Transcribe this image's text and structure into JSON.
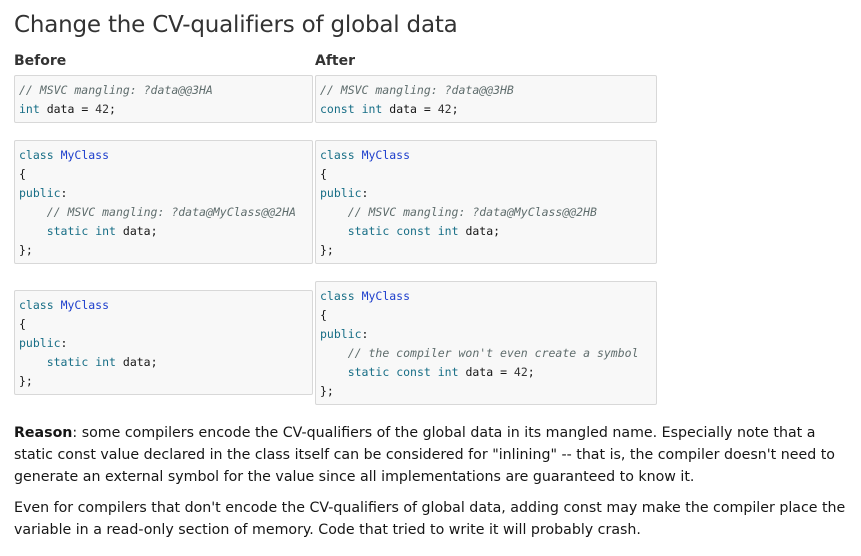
{
  "title": "Change the CV-qualifiers of global data",
  "columns": {
    "before": "Before",
    "after": "After"
  },
  "blocks": [
    {
      "id": "b1-before",
      "lines": [
        [
          {
            "c": "cmt",
            "t": "// MSVC mangling: ?data@@3HA"
          }
        ],
        [
          {
            "c": "kw",
            "t": "int"
          },
          {
            "c": "txt",
            "t": " data = "
          },
          {
            "c": "num",
            "t": "42"
          },
          {
            "c": "txt",
            "t": ";"
          }
        ]
      ]
    },
    {
      "id": "b1-after",
      "lines": [
        [
          {
            "c": "cmt",
            "t": "// MSVC mangling: ?data@@3HB"
          }
        ],
        [
          {
            "c": "kw",
            "t": "const"
          },
          {
            "c": "txt",
            "t": " "
          },
          {
            "c": "kw",
            "t": "int"
          },
          {
            "c": "txt",
            "t": " data = "
          },
          {
            "c": "num",
            "t": "42"
          },
          {
            "c": "txt",
            "t": ";"
          }
        ]
      ]
    },
    {
      "id": "b2-before",
      "lines": [
        [
          {
            "c": "kw",
            "t": "class"
          },
          {
            "c": "txt",
            "t": " "
          },
          {
            "c": "cls",
            "t": "MyClass"
          }
        ],
        [
          {
            "c": "txt",
            "t": "{"
          }
        ],
        [
          {
            "c": "kw",
            "t": "public"
          },
          {
            "c": "txt",
            "t": ":"
          }
        ],
        [
          {
            "c": "txt",
            "t": "    "
          },
          {
            "c": "cmt",
            "t": "// MSVC mangling: ?data@MyClass@@2HA"
          }
        ],
        [
          {
            "c": "txt",
            "t": "    "
          },
          {
            "c": "kw",
            "t": "static"
          },
          {
            "c": "txt",
            "t": " "
          },
          {
            "c": "kw",
            "t": "int"
          },
          {
            "c": "txt",
            "t": " data;"
          }
        ],
        [
          {
            "c": "txt",
            "t": "};"
          }
        ]
      ]
    },
    {
      "id": "b2-after",
      "lines": [
        [
          {
            "c": "kw",
            "t": "class"
          },
          {
            "c": "txt",
            "t": " "
          },
          {
            "c": "cls",
            "t": "MyClass"
          }
        ],
        [
          {
            "c": "txt",
            "t": "{"
          }
        ],
        [
          {
            "c": "kw",
            "t": "public"
          },
          {
            "c": "txt",
            "t": ":"
          }
        ],
        [
          {
            "c": "txt",
            "t": "    "
          },
          {
            "c": "cmt",
            "t": "// MSVC mangling: ?data@MyClass@@2HB"
          }
        ],
        [
          {
            "c": "txt",
            "t": "    "
          },
          {
            "c": "kw",
            "t": "static"
          },
          {
            "c": "txt",
            "t": " "
          },
          {
            "c": "kw",
            "t": "const"
          },
          {
            "c": "txt",
            "t": " "
          },
          {
            "c": "kw",
            "t": "int"
          },
          {
            "c": "txt",
            "t": " data;"
          }
        ],
        [
          {
            "c": "txt",
            "t": "};"
          }
        ]
      ]
    },
    {
      "id": "b3-before",
      "lines": [
        [
          {
            "c": "kw",
            "t": "class"
          },
          {
            "c": "txt",
            "t": " "
          },
          {
            "c": "cls",
            "t": "MyClass"
          }
        ],
        [
          {
            "c": "txt",
            "t": "{"
          }
        ],
        [
          {
            "c": "kw",
            "t": "public"
          },
          {
            "c": "txt",
            "t": ":"
          }
        ],
        [
          {
            "c": "txt",
            "t": "    "
          },
          {
            "c": "kw",
            "t": "static"
          },
          {
            "c": "txt",
            "t": " "
          },
          {
            "c": "kw",
            "t": "int"
          },
          {
            "c": "txt",
            "t": " data;"
          }
        ],
        [
          {
            "c": "txt",
            "t": "};"
          }
        ]
      ]
    },
    {
      "id": "b3-after",
      "lines": [
        [
          {
            "c": "kw",
            "t": "class"
          },
          {
            "c": "txt",
            "t": " "
          },
          {
            "c": "cls",
            "t": "MyClass"
          }
        ],
        [
          {
            "c": "txt",
            "t": "{"
          }
        ],
        [
          {
            "c": "kw",
            "t": "public"
          },
          {
            "c": "txt",
            "t": ":"
          }
        ],
        [
          {
            "c": "txt",
            "t": "    "
          },
          {
            "c": "cmt",
            "t": "// the compiler won't even create a symbol"
          }
        ],
        [
          {
            "c": "txt",
            "t": "    "
          },
          {
            "c": "kw",
            "t": "static"
          },
          {
            "c": "txt",
            "t": " "
          },
          {
            "c": "kw",
            "t": "const"
          },
          {
            "c": "txt",
            "t": " "
          },
          {
            "c": "kw",
            "t": "int"
          },
          {
            "c": "txt",
            "t": " data = "
          },
          {
            "c": "num",
            "t": "42"
          },
          {
            "c": "txt",
            "t": ";"
          }
        ],
        [
          {
            "c": "txt",
            "t": "};"
          }
        ]
      ]
    }
  ],
  "reason": {
    "label": "Reason",
    "text": ": some compilers encode the CV-qualifiers of the global data in its mangled name. Especially note that a static const value declared in the class itself can be considered for \"inlining\" -- that is, the compiler doesn't need to generate an external symbol for the value since all implementations are guaranteed to know it."
  },
  "note": "Even for compilers that don't encode the CV-qualifiers of global data, adding const may make the compiler place the variable in a read-only section of memory. Code that tried to write it will probably crash."
}
